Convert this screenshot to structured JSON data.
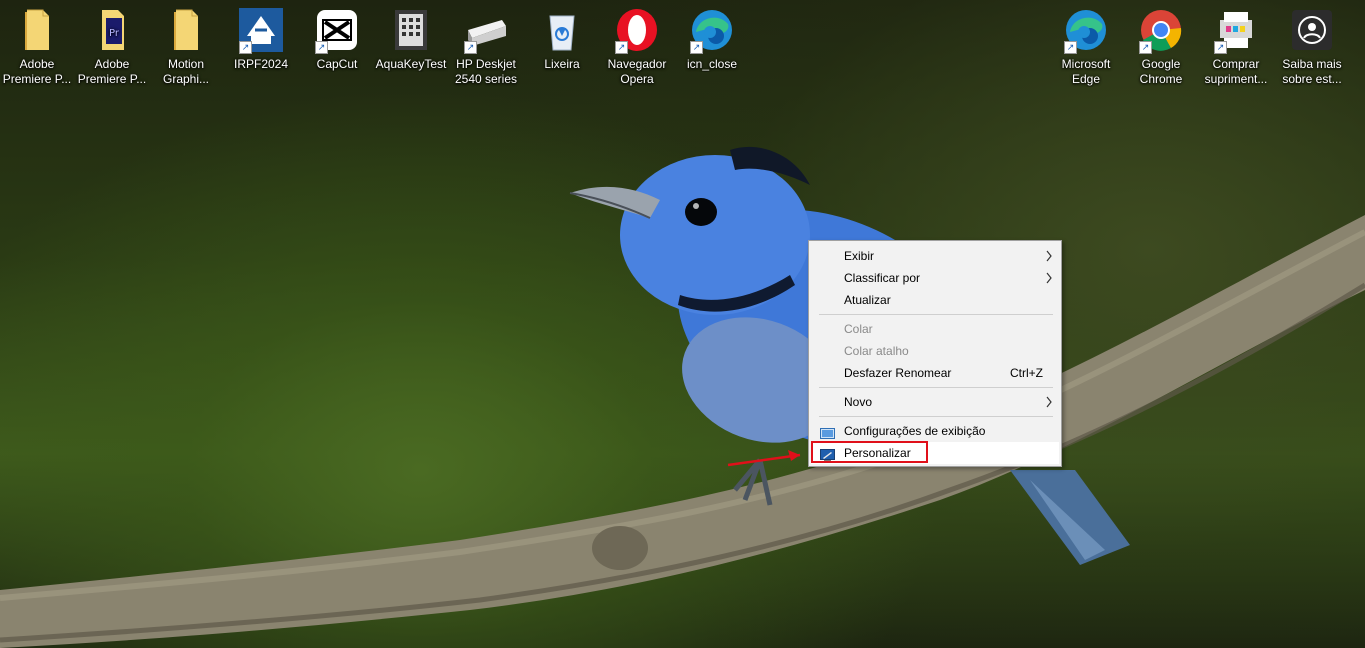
{
  "desktop": {
    "icons_left": [
      {
        "label": "Adobe\nPremiere P...",
        "icon": "folder-icon"
      },
      {
        "label": "Adobe\nPremiere P...",
        "icon": "premiere-folder-icon"
      },
      {
        "label": "Motion\nGraphi...",
        "icon": "folder-icon"
      },
      {
        "label": "IRPF2024",
        "icon": "irpf-icon"
      },
      {
        "label": "CapCut",
        "icon": "capcut-icon"
      },
      {
        "label": "AquaKeyTest",
        "icon": "keypad-icon"
      },
      {
        "label": "HP Deskjet\n2540 series",
        "icon": "printer-icon"
      },
      {
        "label": "Lixeira",
        "icon": "recycle-bin-icon"
      },
      {
        "label": "Navegador\nOpera",
        "icon": "opera-icon"
      },
      {
        "label": "icn_close",
        "icon": "edge-icon"
      }
    ],
    "icons_right": [
      {
        "label": "Microsoft\nEdge",
        "icon": "edge-icon"
      },
      {
        "label": "Google\nChrome",
        "icon": "chrome-icon"
      },
      {
        "label": "Comprar\nsupriment...",
        "icon": "printer-supplies-icon"
      },
      {
        "label": "Saiba mais\nsobre est...",
        "icon": "camera-icon"
      }
    ]
  },
  "context_menu": {
    "items": [
      {
        "label": "Exibir",
        "submenu": true
      },
      {
        "label": "Classificar por",
        "submenu": true
      },
      {
        "label": "Atualizar"
      },
      {
        "label": "Colar",
        "disabled": true
      },
      {
        "label": "Colar atalho",
        "disabled": true
      },
      {
        "label": "Desfazer Renomear",
        "shortcut": "Ctrl+Z"
      },
      {
        "label": "Novo",
        "submenu": true
      },
      {
        "label": "Configurações de exibição",
        "icon": "display-settings-icon"
      },
      {
        "label": "Personalizar",
        "icon": "personalize-icon",
        "highlighted": true
      }
    ],
    "submenu_arrow": "›"
  },
  "colors": {
    "highlight_box": "#e0101a",
    "bird_blue": "#3f78d8"
  }
}
